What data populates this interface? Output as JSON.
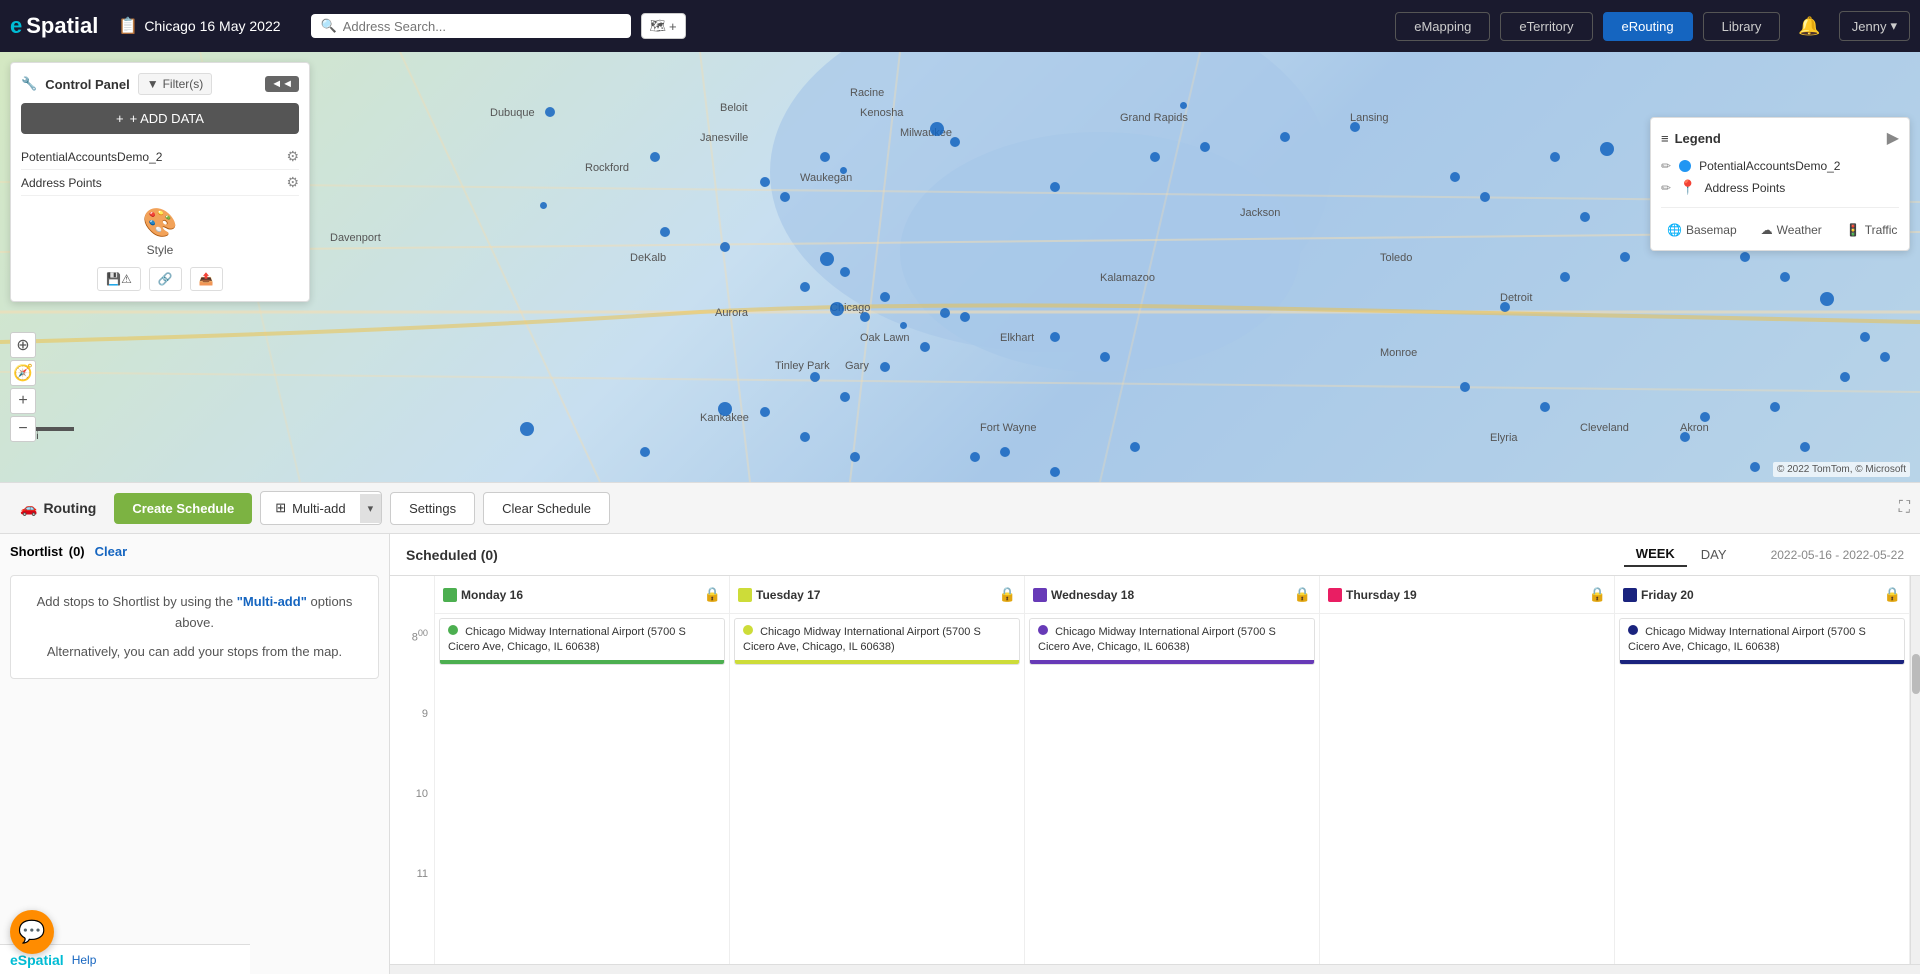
{
  "app": {
    "name": "eSpatial",
    "title_color": "#00bcd4"
  },
  "header": {
    "map_title": "Chicago 16 May 2022",
    "map_icon": "📋",
    "search_placeholder": "Address Search...",
    "add_pin_label": "🗺+",
    "nav_buttons": [
      "eMapping",
      "eTerritory",
      "eRouting",
      "Library"
    ],
    "active_nav": "eRouting",
    "user_label": "Jenny"
  },
  "control_panel": {
    "title": "Control Panel",
    "filter_label": "Filter(s)",
    "add_data_label": "+ ADD DATA",
    "layers": [
      {
        "name": "PotentialAccountsDemo_2"
      },
      {
        "name": "Address Points"
      }
    ],
    "style_label": "Style",
    "actions": [
      "save-warning",
      "share",
      "export"
    ]
  },
  "legend": {
    "title": "Legend",
    "items": [
      {
        "name": "PotentialAccountsDemo_2",
        "type": "circle",
        "color": "#2196f3"
      },
      {
        "name": "Address Points",
        "type": "pin",
        "color": "#e53935"
      }
    ],
    "basemap_label": "Basemap",
    "weather_label": "Weather",
    "traffic_label": "Traffic"
  },
  "toolbar": {
    "routing_label": "Routing",
    "create_schedule_label": "Create Schedule",
    "multi_add_label": "Multi-add",
    "settings_label": "Settings",
    "clear_schedule_label": "Clear Schedule"
  },
  "shortlist": {
    "title": "Shortlist",
    "count": "(0)",
    "clear_label": "Clear",
    "hint_line1": "Add stops to Shortlist by using the",
    "hint_bold": "\"Multi-add\"",
    "hint_line2": "options above.",
    "hint_line3": "Alternatively, you can add your stops from the map."
  },
  "scheduled": {
    "title": "Scheduled",
    "count": "(0)",
    "week_label": "WEEK",
    "day_label": "DAY",
    "date_range": "2022-05-16 - 2022-05-22",
    "days": [
      {
        "label": "Monday 16",
        "color": "#4caf50",
        "has_event": true
      },
      {
        "label": "Tuesday 17",
        "color": "#cddc39",
        "has_event": true
      },
      {
        "label": "Wednesday 18",
        "color": "#673ab7",
        "has_event": true
      },
      {
        "label": "Thursday 19",
        "color": "#e91e63",
        "has_event": false
      },
      {
        "label": "Friday 20",
        "color": "#1a237e",
        "has_event": true
      }
    ],
    "event": {
      "name": "Chicago Midway International Airport (5700 S Cicero Ave, Chicago, IL 60638)",
      "short": "Chicago Midway International Airport (5700 S Cicero Ave, Chicago, IL 60638)"
    },
    "time_labels": [
      "8:00",
      "9:00",
      "10:00",
      "11:00"
    ]
  },
  "map": {
    "scale": "30 mi",
    "attribution": "© 2022 TomTom, © Microsoft"
  },
  "footer": {
    "logo": "eSpatial",
    "help_label": "Help"
  }
}
